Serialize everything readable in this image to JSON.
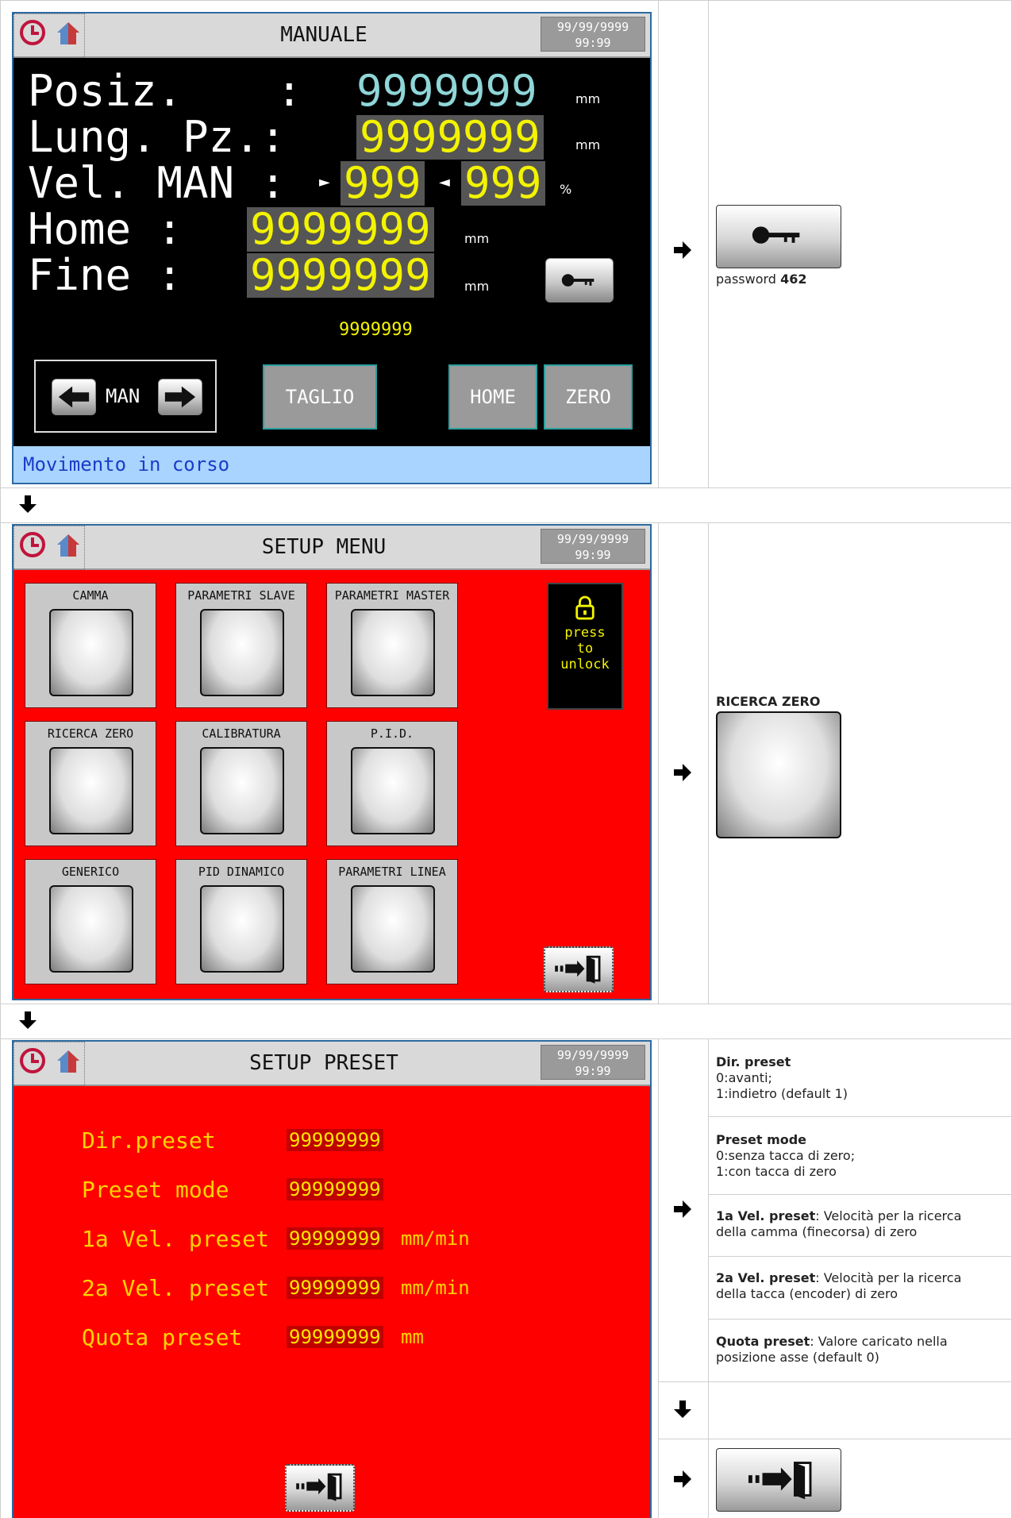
{
  "colors": {
    "hmi_black": "#000000",
    "hmi_red": "#ff0000",
    "value_yellow": "#f3f300",
    "value_cyan": "#8fd6d8",
    "status_bg": "#a8d4ff",
    "status_text": "#1a3cc8"
  },
  "common": {
    "date": "99/99/9999",
    "time": "99:99"
  },
  "manuale": {
    "title": "MANUALE",
    "rows": [
      {
        "label": "Posiz.      :",
        "value": "9999999",
        "unit": "mm"
      },
      {
        "label": "Lung. Pz.:",
        "value": "9999999",
        "unit": "mm"
      },
      {
        "label": "Vel. MAN :",
        "value_a": "999",
        "value_b": "999",
        "unit": "%"
      },
      {
        "label": "Home :",
        "value": "9999999",
        "unit": "mm"
      },
      {
        "label": "Fine  :",
        "value": "9999999",
        "unit": "mm"
      }
    ],
    "small_value": "9999999",
    "man_label": "MAN",
    "buttons": {
      "taglio": "TAGLIO",
      "home": "HOME",
      "zero": "ZERO"
    },
    "status": "Movimento in corso"
  },
  "step1_note": {
    "prefix": "password",
    "code": "462"
  },
  "setup_menu": {
    "title": "SETUP MENU",
    "tiles": [
      "CAMMA",
      "PARAMETRI SLAVE",
      "PARAMETRI MASTER",
      "RICERCA ZERO",
      "CALIBRATURA",
      "P.I.D.",
      "GENERICO",
      "PID DINAMICO",
      "PARAMETRI LINEA"
    ],
    "lock": {
      "l1": "press",
      "l2": "to",
      "l3": "unlock"
    }
  },
  "step2_note": {
    "title": "RICERCA ZERO"
  },
  "setup_preset": {
    "title": "SETUP PRESET",
    "rows": [
      {
        "label": "Dir.preset",
        "value": "99999999",
        "unit": ""
      },
      {
        "label": "Preset mode",
        "value": "99999999",
        "unit": ""
      },
      {
        "label": "1a Vel. preset",
        "value": "99999999",
        "unit": "mm/min"
      },
      {
        "label": "2a Vel. preset",
        "value": "99999999",
        "unit": "mm/min"
      },
      {
        "label": "Quota preset",
        "value": "99999999",
        "unit": "mm"
      }
    ]
  },
  "descriptions": [
    {
      "title": "Dir. preset",
      "lines": [
        "0:avanti;",
        "1:indietro (default 1)"
      ]
    },
    {
      "title": "Preset mode",
      "lines": [
        "0:senza tacca di zero;",
        "1:con tacca di zero"
      ]
    },
    {
      "title": "1a Vel. preset",
      "text": ": Velocità per la ricerca",
      "text2": "della camma (finecorsa) di zero"
    },
    {
      "title": "2a Vel. preset",
      "text": ": Velocità per la ricerca",
      "text2": "della tacca (encoder) di zero"
    },
    {
      "title": "Quota preset",
      "text": ": Valore caricato nella",
      "text2": "posizione asse (default 0)"
    }
  ]
}
